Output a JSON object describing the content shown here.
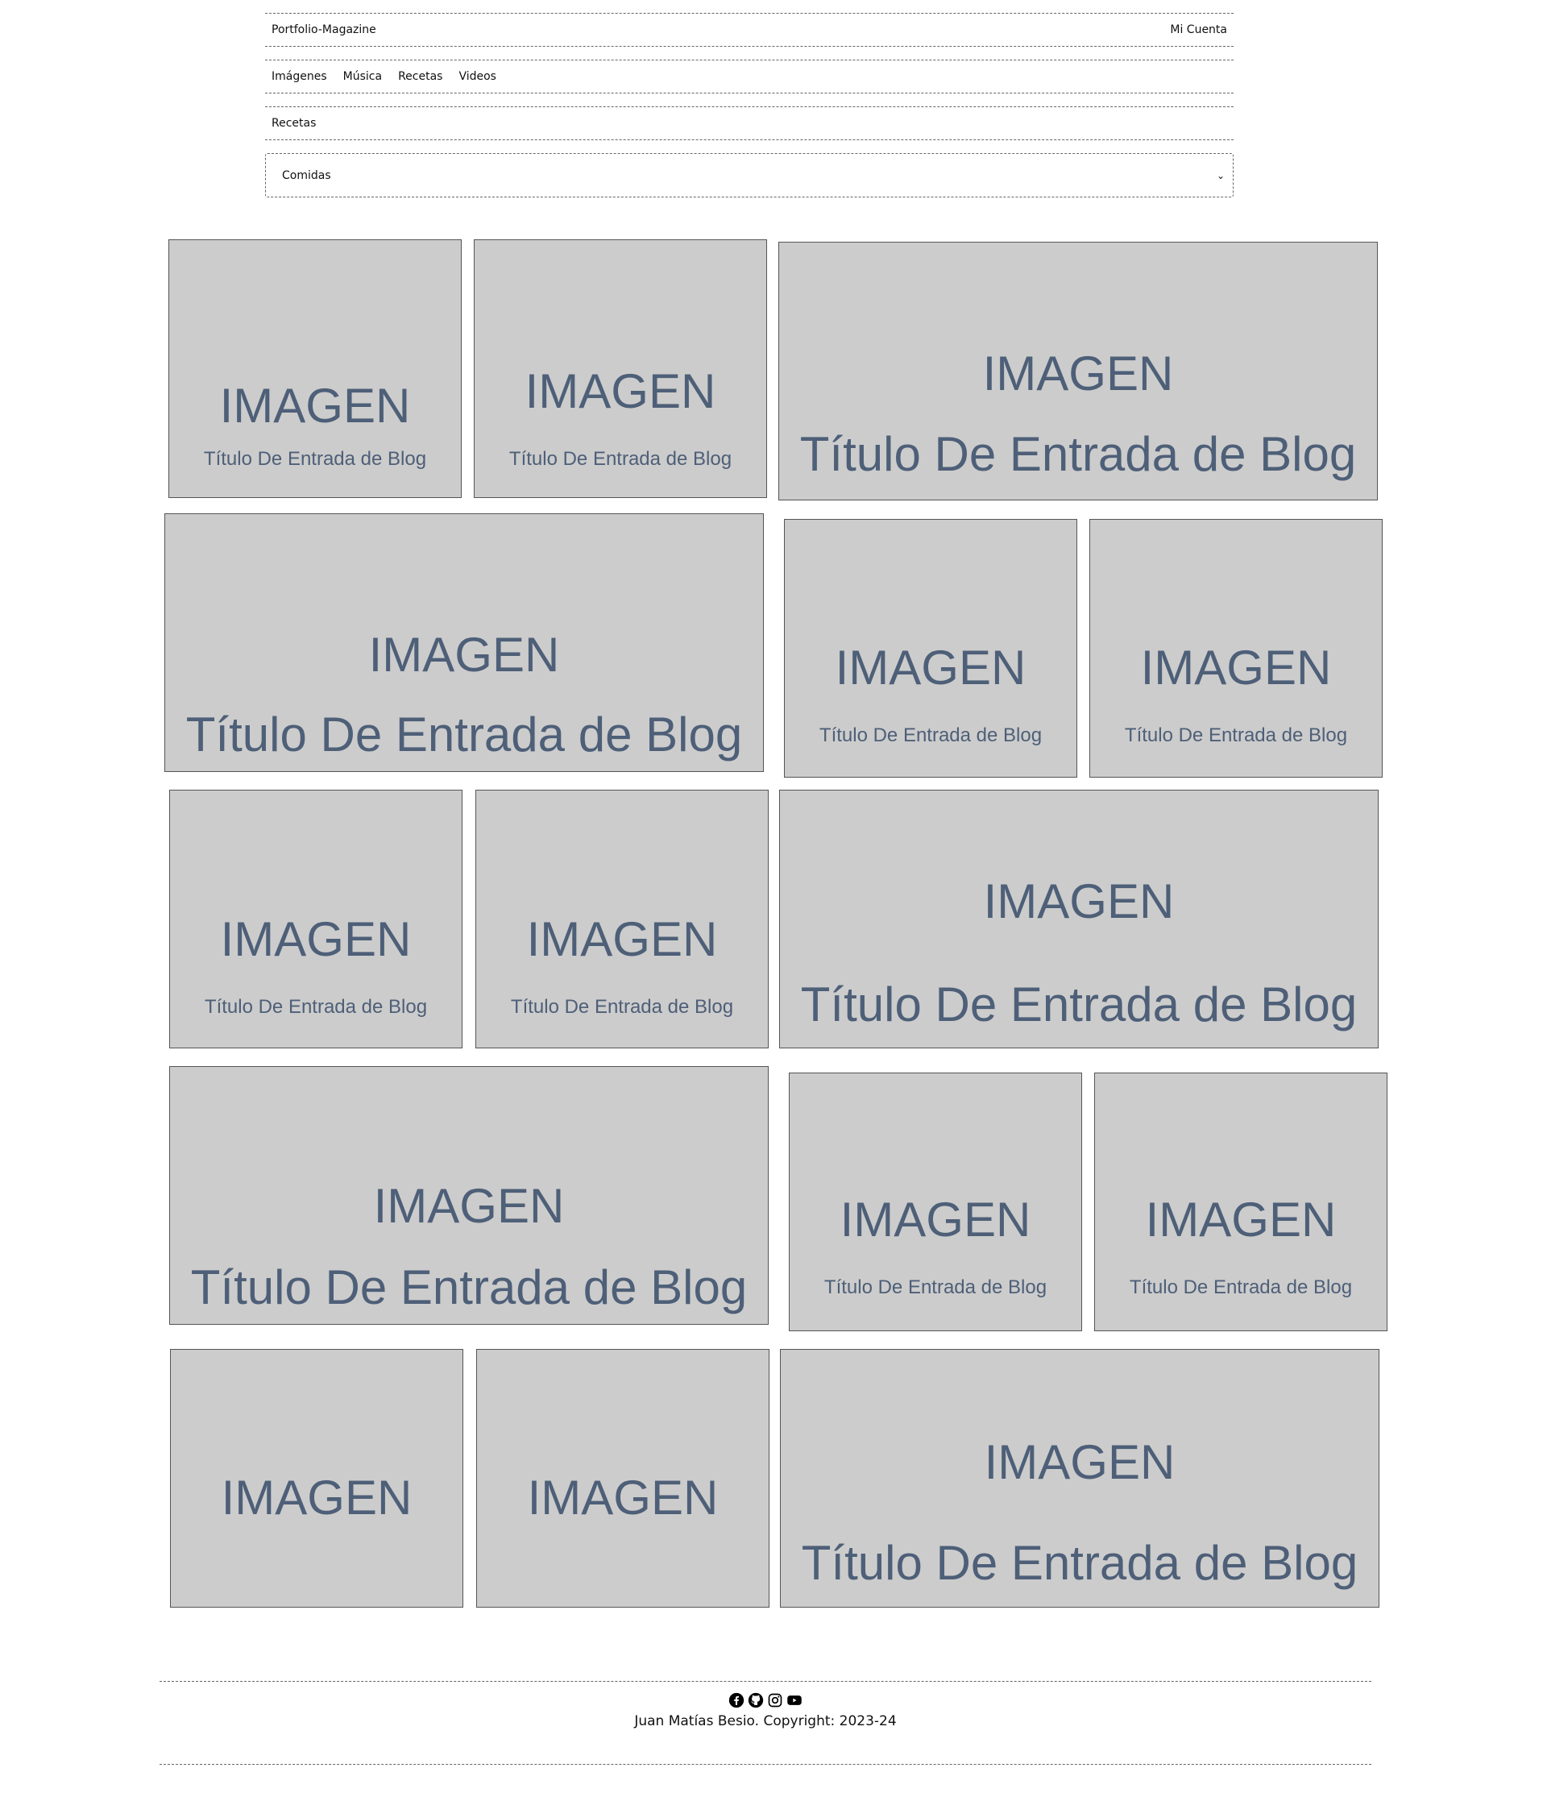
{
  "header": {
    "brand": "Portfolio-Magazine",
    "account": "Mi Cuenta"
  },
  "nav": {
    "items": [
      "Imágenes",
      "Música",
      "Recetas",
      "Videos"
    ]
  },
  "breadcrumb": "Recetas",
  "filter": {
    "selected": "Comidas"
  },
  "cards": [
    {
      "image_label": "IMAGEN",
      "title": "Título De Entrada de Blog"
    },
    {
      "image_label": "IMAGEN",
      "title": "Título De Entrada de Blog"
    },
    {
      "image_label": "IMAGEN",
      "title": "Título De Entrada de Blog"
    },
    {
      "image_label": "IMAGEN",
      "title": "Título De Entrada de Blog"
    },
    {
      "image_label": "IMAGEN",
      "title": "Título De Entrada de Blog"
    },
    {
      "image_label": "IMAGEN",
      "title": "Título De Entrada de Blog"
    },
    {
      "image_label": "IMAGEN",
      "title": "Título De Entrada de Blog"
    },
    {
      "image_label": "IMAGEN",
      "title": "Título De Entrada de Blog"
    },
    {
      "image_label": "IMAGEN",
      "title": "Título De Entrada de Blog"
    },
    {
      "image_label": "IMAGEN",
      "title": "Título De Entrada de Blog"
    },
    {
      "image_label": "IMAGEN",
      "title": "Título De Entrada de Blog"
    },
    {
      "image_label": "IMAGEN",
      "title": "Título De Entrada de Blog"
    },
    {
      "image_label": "IMAGEN",
      "title": ""
    },
    {
      "image_label": "IMAGEN",
      "title": ""
    },
    {
      "image_label": "IMAGEN",
      "title": "Título De Entrada de Blog"
    }
  ],
  "footer": {
    "icons": [
      "facebook-icon",
      "github-icon",
      "instagram-icon",
      "youtube-icon"
    ],
    "copyright": "Juan Matías Besio. Copyright: 2023-24"
  },
  "colors": {
    "card_bg": "#cccccc",
    "card_text": "#4e5f78",
    "border": "#555555"
  }
}
